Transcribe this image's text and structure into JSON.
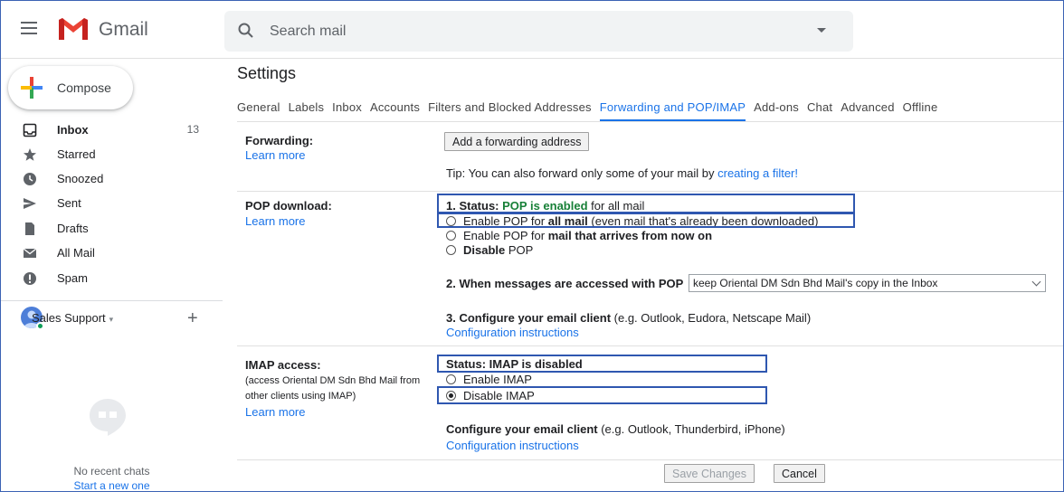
{
  "header": {
    "brand": "Gmail",
    "search_placeholder": "Search mail"
  },
  "sidebar": {
    "compose_label": "Compose",
    "items": [
      {
        "label": "Inbox",
        "count": "13",
        "icon": "inbox-icon"
      },
      {
        "label": "Starred",
        "count": "",
        "icon": "star-icon"
      },
      {
        "label": "Snoozed",
        "count": "",
        "icon": "clock-icon"
      },
      {
        "label": "Sent",
        "count": "",
        "icon": "send-icon"
      },
      {
        "label": "Drafts",
        "count": "",
        "icon": "draft-icon"
      },
      {
        "label": "All Mail",
        "count": "",
        "icon": "mail-icon"
      },
      {
        "label": "Spam",
        "count": "",
        "icon": "spam-icon"
      }
    ],
    "hangouts_user": "Sales Support",
    "hangouts_caret": "▾",
    "hangouts_add": "+",
    "no_chats": "No recent chats",
    "start_chat": "Start a new one"
  },
  "settings": {
    "title": "Settings",
    "tabs": [
      "General",
      "Labels",
      "Inbox",
      "Accounts",
      "Filters and Blocked Addresses",
      "Forwarding and POP/IMAP",
      "Add-ons",
      "Chat",
      "Advanced",
      "Offline"
    ],
    "active_tab": "Forwarding and POP/IMAP",
    "forwarding": {
      "label": "Forwarding:",
      "learn_more": "Learn more",
      "add_button": "Add a forwarding address",
      "tip_prefix": "Tip: You can also forward only some of your mail by ",
      "tip_link": "creating a filter!"
    },
    "pop": {
      "label": "POP download:",
      "learn_more": "Learn more",
      "status_prefix": "1. Status: ",
      "status_value": "POP is enabled",
      "status_suffix": " for all mail",
      "option1_prefix": "Enable POP for ",
      "option1_bold": "all mail",
      "option1_suffix": " (even mail that's already been downloaded)",
      "option2_prefix": "Enable POP for ",
      "option2_bold": "mail that arrives from now on",
      "option3_bold": "Disable",
      "option3_suffix": " POP",
      "access_label": "2. When messages are accessed with POP",
      "access_selected": "keep Oriental DM Sdn Bhd Mail's copy in the Inbox",
      "configure_bold": "3. Configure your email client",
      "configure_suffix": " (e.g. Outlook, Eudora, Netscape Mail)",
      "config_link": "Configuration instructions"
    },
    "imap": {
      "label": "IMAP access:",
      "sub1": "(access Oriental DM Sdn Bhd Mail from",
      "sub2": "other clients using IMAP)",
      "learn_more": "Learn more",
      "status": "Status: IMAP is disabled",
      "enable_label": "Enable IMAP",
      "disable_label": "Disable IMAP",
      "disable_checked": true,
      "configure_bold": "Configure your email client",
      "configure_suffix": " (e.g. Outlook, Thunderbird, iPhone)",
      "config_link": "Configuration instructions"
    },
    "save_button": "Save Changes",
    "cancel_button": "Cancel"
  },
  "colors": {
    "accent": "#1a73e8",
    "pop_enabled": "#188038",
    "highlight_box": "#2f57b0",
    "gmail_red": "#ea4335"
  }
}
